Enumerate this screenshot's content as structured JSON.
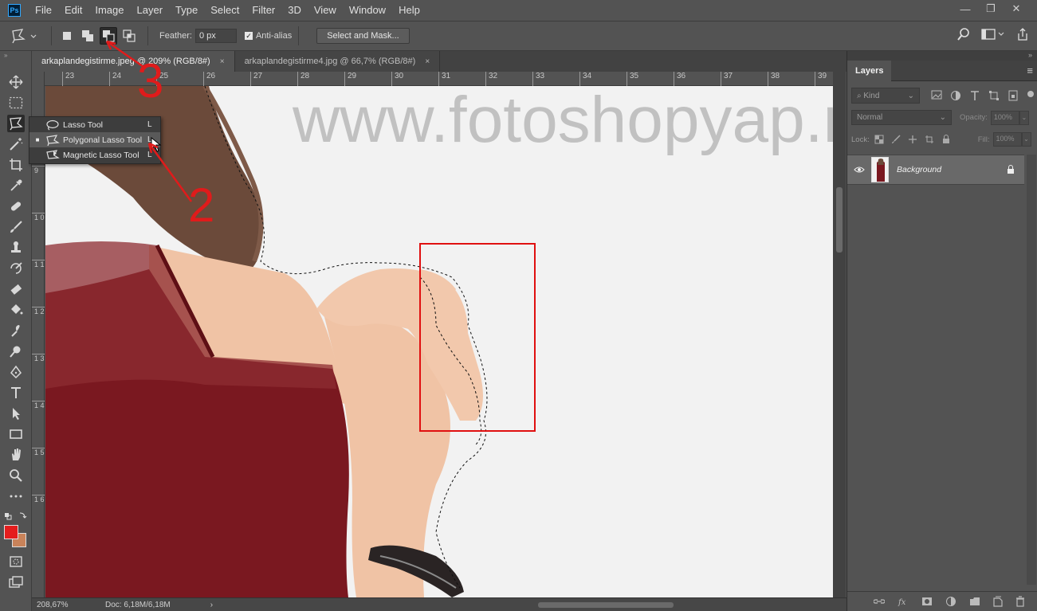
{
  "menubar": {
    "logo": "Ps",
    "items": [
      "File",
      "Edit",
      "Image",
      "Layer",
      "Type",
      "Select",
      "Filter",
      "3D",
      "View",
      "Window",
      "Help"
    ],
    "window_controls": [
      "—",
      "❐",
      "✕"
    ]
  },
  "options": {
    "feather_label": "Feather:",
    "feather_value": "0 px",
    "antialias_label": "Anti-alias",
    "antialias_checked": true,
    "select_mask_label": "Select and Mask...",
    "selection_modes": [
      "new-selection",
      "add-to-selection",
      "subtract-from-selection",
      "intersect-with-selection"
    ],
    "active_mode": "subtract-from-selection"
  },
  "tabs": [
    {
      "label": "arkaplandegistirme.jpeg @ 209% (RGB/8#)",
      "active": true,
      "close": "×"
    },
    {
      "label": "arkaplandegistirme4.jpg @ 66,7% (RGB/8#)",
      "active": false,
      "close": "×"
    }
  ],
  "ruler": {
    "top": [
      "23",
      "24",
      "25",
      "26",
      "27",
      "28",
      "29",
      "30",
      "31",
      "32",
      "33",
      "34",
      "35",
      "36",
      "37",
      "38",
      "39"
    ],
    "left": [
      "9",
      "1 0",
      "1 1",
      "1 2",
      "1 3",
      "1 4",
      "1 5",
      "1 6"
    ]
  },
  "canvas": {
    "watermark": "www.fotoshopyap.net",
    "skin_color": "#f0c3a5",
    "dress_color": "#7a1820",
    "hair_color": "#6b4a3a",
    "background_color": "#f2f2f2"
  },
  "flyout": {
    "items": [
      {
        "label": "Lasso Tool",
        "shortcut": "L",
        "icon": "lasso-icon",
        "active": false
      },
      {
        "label": "Polygonal Lasso Tool",
        "shortcut": "L",
        "icon": "polygonal-lasso-icon",
        "active": true
      },
      {
        "label": "Magnetic Lasso Tool",
        "shortcut": "L",
        "icon": "magnetic-lasso-icon",
        "active": false
      }
    ]
  },
  "annotations": {
    "step_2": "2",
    "step_3": "3",
    "color": "#e01b1b"
  },
  "status": {
    "zoom": "208,67%",
    "doc": "Doc: 6,18M/6,18M",
    "arrow": "›"
  },
  "colors": {
    "foreground": "#e41d1d",
    "background": "#c9835a"
  },
  "layers_panel": {
    "title": "Layers",
    "kind_label": "Kind",
    "blend_mode": "Normal",
    "opacity_label": "Opacity:",
    "opacity_value": "100%",
    "lock_label": "Lock:",
    "fill_label": "Fill:",
    "fill_value": "100%",
    "layers": [
      {
        "name": "Background",
        "visible": true,
        "locked": true
      }
    ]
  }
}
